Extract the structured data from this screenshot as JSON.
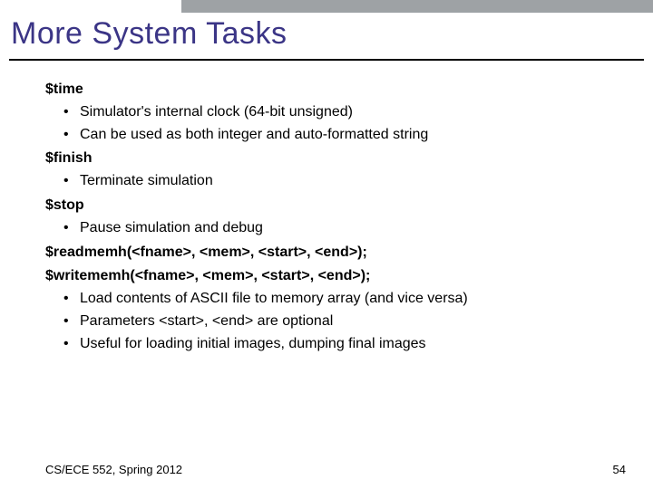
{
  "title": "More System Tasks",
  "content": {
    "h1": "$time",
    "b1": "Simulator's internal clock (64-bit unsigned)",
    "b2": "Can be used as both integer and auto-formatted string",
    "h2": "$finish",
    "b3": "Terminate simulation",
    "h3": "$stop",
    "b4": "Pause simulation and debug",
    "h4": "$readmemh(<fname>, <mem>, <start>, <end>);",
    "h5": "$writememh(<fname>, <mem>, <start>, <end>);",
    "b5": "Load contents of ASCII file to memory array (and vice versa)",
    "b6": "Parameters <start>, <end> are optional",
    "b7": "Useful for loading initial images, dumping final images"
  },
  "footer": {
    "left": "CS/ECE 552, Spring 2012",
    "right": "54"
  }
}
